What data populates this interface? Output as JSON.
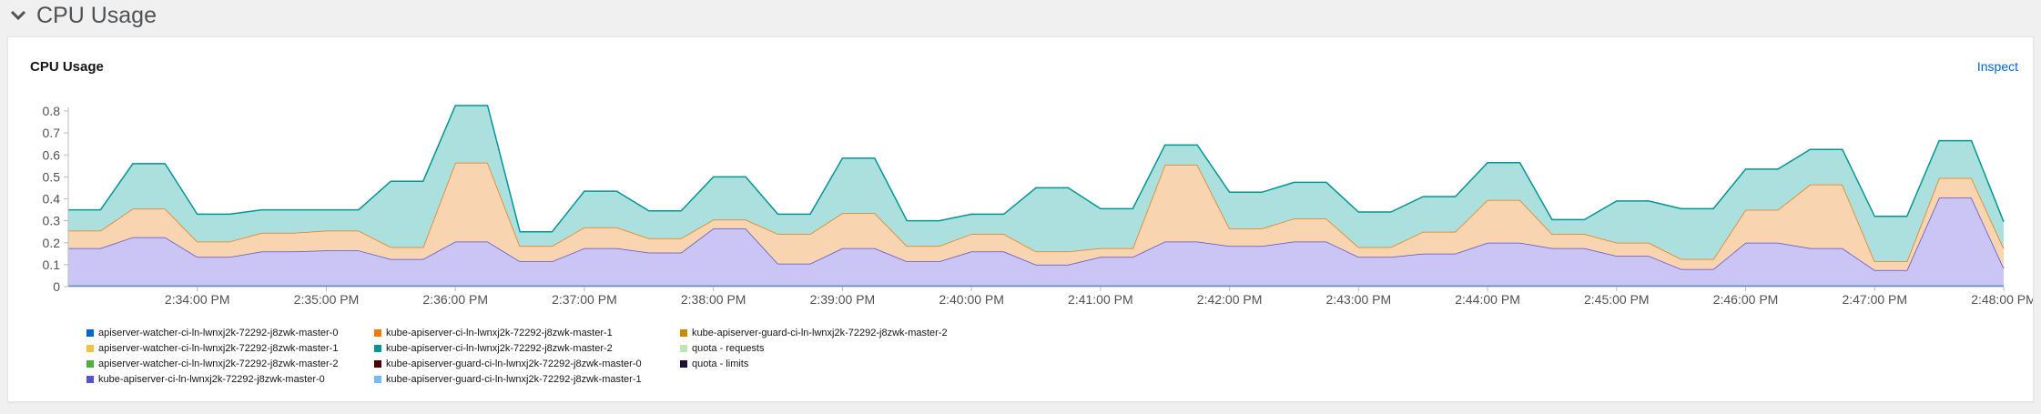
{
  "section": {
    "title": "CPU Usage",
    "toggle_icon": "chevron-down-icon"
  },
  "card": {
    "title": "CPU Usage",
    "inspect_label": "Inspect"
  },
  "chart_data": {
    "type": "area",
    "stacked": true,
    "x": [
      "2:33:00",
      "2:33:15",
      "2:33:30",
      "2:33:45",
      "2:34:00",
      "2:34:15",
      "2:34:30",
      "2:34:45",
      "2:35:00",
      "2:35:15",
      "2:35:30",
      "2:35:45",
      "2:36:00",
      "2:36:15",
      "2:36:30",
      "2:36:45",
      "2:37:00",
      "2:37:15",
      "2:37:30",
      "2:37:45",
      "2:38:00",
      "2:38:15",
      "2:38:30",
      "2:38:45",
      "2:39:00",
      "2:39:15",
      "2:39:30",
      "2:39:45",
      "2:40:00",
      "2:40:15",
      "2:40:30",
      "2:40:45",
      "2:41:00",
      "2:41:15",
      "2:41:30",
      "2:41:45",
      "2:42:00",
      "2:42:15",
      "2:42:30",
      "2:42:45",
      "2:43:00",
      "2:43:15",
      "2:43:30",
      "2:43:45",
      "2:44:00",
      "2:44:15",
      "2:44:30",
      "2:44:45",
      "2:45:00",
      "2:45:15",
      "2:45:30",
      "2:45:45",
      "2:46:00",
      "2:46:15",
      "2:46:30",
      "2:46:45",
      "2:47:00",
      "2:47:15",
      "2:47:30",
      "2:47:45",
      "2:48:00"
    ],
    "x_ticks": [
      "2:34:00 PM",
      "2:35:00 PM",
      "2:36:00 PM",
      "2:37:00 PM",
      "2:38:00 PM",
      "2:39:00 PM",
      "2:40:00 PM",
      "2:41:00 PM",
      "2:42:00 PM",
      "2:43:00 PM",
      "2:44:00 PM",
      "2:45:00 PM",
      "2:46:00 PM",
      "2:47:00 PM",
      "2:48:00 PM"
    ],
    "y_ticks": [
      "0",
      "0.1",
      "0.2",
      "0.3",
      "0.4",
      "0.5",
      "0.6",
      "0.7",
      "0.8"
    ],
    "ylim": [
      0,
      0.8
    ],
    "grid": false,
    "legend_position": "bottom",
    "series": [
      {
        "name": "apiserver-watcher-ci-ln-lwnxj2k-72292-j8zwk-master-0",
        "color": "#0066cc",
        "values": [
          0.005,
          0.005,
          0.005,
          0.005,
          0.005,
          0.005,
          0.005,
          0.005,
          0.005,
          0.005,
          0.005,
          0.005,
          0.005,
          0.005,
          0.005,
          0.005,
          0.005,
          0.005,
          0.005,
          0.005,
          0.005,
          0.005,
          0.005,
          0.005,
          0.005,
          0.005,
          0.005,
          0.005,
          0.005,
          0.005,
          0.005,
          0.005,
          0.005,
          0.005,
          0.005,
          0.005,
          0.005,
          0.005,
          0.005,
          0.005,
          0.005,
          0.005,
          0.005,
          0.005,
          0.005,
          0.005,
          0.005,
          0.005,
          0.005,
          0.005,
          0.005,
          0.005,
          0.005,
          0.005,
          0.005,
          0.005,
          0.005,
          0.005,
          0.005,
          0.005,
          0.005
        ]
      },
      {
        "name": "apiserver-watcher-ci-ln-lwnxj2k-72292-j8zwk-master-1",
        "color": "#f4c145",
        "values": [
          0,
          0,
          0,
          0,
          0,
          0,
          0,
          0,
          0,
          0,
          0,
          0,
          0,
          0,
          0,
          0,
          0,
          0,
          0,
          0,
          0,
          0,
          0,
          0,
          0,
          0,
          0,
          0,
          0,
          0,
          0,
          0,
          0,
          0,
          0,
          0,
          0,
          0,
          0,
          0,
          0,
          0,
          0,
          0,
          0,
          0,
          0,
          0,
          0,
          0,
          0,
          0,
          0,
          0,
          0,
          0,
          0,
          0,
          0,
          0,
          0
        ]
      },
      {
        "name": "apiserver-watcher-ci-ln-lwnxj2k-72292-j8zwk-master-2",
        "color": "#4cb140",
        "values": [
          0,
          0,
          0,
          0,
          0,
          0,
          0,
          0,
          0,
          0,
          0,
          0,
          0,
          0,
          0,
          0,
          0,
          0,
          0,
          0,
          0,
          0,
          0,
          0,
          0,
          0,
          0,
          0,
          0,
          0,
          0,
          0,
          0,
          0,
          0,
          0,
          0,
          0,
          0,
          0,
          0,
          0,
          0,
          0,
          0,
          0,
          0,
          0,
          0,
          0,
          0,
          0,
          0,
          0,
          0,
          0,
          0,
          0,
          0,
          0,
          0
        ]
      },
      {
        "name": "kube-apiserver-ci-ln-lwnxj2k-72292-j8zwk-master-0",
        "color": "#5752d1",
        "fill": "#cbc5f5",
        "values": [
          0.17,
          0.17,
          0.22,
          0.22,
          0.13,
          0.13,
          0.155,
          0.155,
          0.16,
          0.16,
          0.12,
          0.12,
          0.2,
          0.2,
          0.11,
          0.11,
          0.17,
          0.17,
          0.15,
          0.15,
          0.26,
          0.26,
          0.1,
          0.1,
          0.17,
          0.17,
          0.11,
          0.11,
          0.155,
          0.155,
          0.095,
          0.095,
          0.13,
          0.13,
          0.2,
          0.2,
          0.18,
          0.18,
          0.2,
          0.2,
          0.13,
          0.13,
          0.145,
          0.145,
          0.195,
          0.195,
          0.17,
          0.17,
          0.135,
          0.135,
          0.075,
          0.075,
          0.195,
          0.195,
          0.17,
          0.17,
          0.07,
          0.07,
          0.4,
          0.4,
          0.08
        ]
      },
      {
        "name": "kube-apiserver-ci-ln-lwnxj2k-72292-j8zwk-master-1",
        "color": "#ec7a08",
        "fill": "#f8d4b0",
        "values": [
          0.08,
          0.08,
          0.13,
          0.13,
          0.07,
          0.07,
          0.085,
          0.085,
          0.09,
          0.09,
          0.055,
          0.055,
          0.36,
          0.36,
          0.07,
          0.07,
          0.095,
          0.095,
          0.065,
          0.065,
          0.04,
          0.04,
          0.135,
          0.135,
          0.16,
          0.16,
          0.07,
          0.07,
          0.08,
          0.08,
          0.06,
          0.06,
          0.04,
          0.04,
          0.35,
          0.35,
          0.08,
          0.08,
          0.105,
          0.105,
          0.045,
          0.045,
          0.1,
          0.1,
          0.195,
          0.195,
          0.065,
          0.065,
          0.06,
          0.06,
          0.045,
          0.045,
          0.15,
          0.15,
          0.29,
          0.29,
          0.04,
          0.04,
          0.09,
          0.09,
          0.09
        ]
      },
      {
        "name": "kube-apiserver-ci-ln-lwnxj2k-72292-j8zwk-master-2",
        "color": "#009596",
        "fill": "#ace0de",
        "values": [
          0.095,
          0.095,
          0.205,
          0.205,
          0.125,
          0.125,
          0.105,
          0.105,
          0.095,
          0.095,
          0.3,
          0.3,
          0.26,
          0.26,
          0.065,
          0.065,
          0.165,
          0.165,
          0.125,
          0.125,
          0.195,
          0.195,
          0.09,
          0.09,
          0.25,
          0.25,
          0.115,
          0.115,
          0.09,
          0.09,
          0.29,
          0.29,
          0.18,
          0.18,
          0.09,
          0.09,
          0.165,
          0.165,
          0.165,
          0.165,
          0.16,
          0.16,
          0.16,
          0.16,
          0.17,
          0.17,
          0.065,
          0.065,
          0.19,
          0.19,
          0.23,
          0.23,
          0.185,
          0.185,
          0.16,
          0.16,
          0.205,
          0.205,
          0.17,
          0.17,
          0.12
        ]
      },
      {
        "name": "kube-apiserver-guard-ci-ln-lwnxj2k-72292-j8zwk-master-0",
        "color": "#470000",
        "values": [
          0,
          0,
          0,
          0,
          0,
          0,
          0,
          0,
          0,
          0,
          0,
          0,
          0,
          0,
          0,
          0,
          0,
          0,
          0,
          0,
          0,
          0,
          0,
          0,
          0,
          0,
          0,
          0,
          0,
          0,
          0,
          0,
          0,
          0,
          0,
          0,
          0,
          0,
          0,
          0,
          0,
          0,
          0,
          0,
          0,
          0,
          0,
          0,
          0,
          0,
          0,
          0,
          0,
          0,
          0,
          0,
          0,
          0,
          0,
          0,
          0
        ]
      },
      {
        "name": "kube-apiserver-guard-ci-ln-lwnxj2k-72292-j8zwk-master-1",
        "color": "#73bcf7",
        "values": [
          0,
          0,
          0,
          0,
          0,
          0,
          0,
          0,
          0,
          0,
          0,
          0,
          0,
          0,
          0,
          0,
          0,
          0,
          0,
          0,
          0,
          0,
          0,
          0,
          0,
          0,
          0,
          0,
          0,
          0,
          0,
          0,
          0,
          0,
          0,
          0,
          0,
          0,
          0,
          0,
          0,
          0,
          0,
          0,
          0,
          0,
          0,
          0,
          0,
          0,
          0,
          0,
          0,
          0,
          0,
          0,
          0,
          0,
          0,
          0,
          0
        ]
      },
      {
        "name": "kube-apiserver-guard-ci-ln-lwnxj2k-72292-j8zwk-master-2",
        "color": "#c58c00",
        "values": [
          0,
          0,
          0,
          0,
          0,
          0,
          0,
          0,
          0,
          0,
          0,
          0,
          0,
          0,
          0,
          0,
          0,
          0,
          0,
          0,
          0,
          0,
          0,
          0,
          0,
          0,
          0,
          0,
          0,
          0,
          0,
          0,
          0,
          0,
          0,
          0,
          0,
          0,
          0,
          0,
          0,
          0,
          0,
          0,
          0,
          0,
          0,
          0,
          0,
          0,
          0,
          0,
          0,
          0,
          0,
          0,
          0,
          0,
          0,
          0,
          0
        ]
      }
    ],
    "legend": [
      {
        "label": "apiserver-watcher-ci-ln-lwnxj2k-72292-j8zwk-master-0",
        "color": "#0066cc"
      },
      {
        "label": "apiserver-watcher-ci-ln-lwnxj2k-72292-j8zwk-master-1",
        "color": "#f4c145"
      },
      {
        "label": "apiserver-watcher-ci-ln-lwnxj2k-72292-j8zwk-master-2",
        "color": "#4cb140"
      },
      {
        "label": "kube-apiserver-ci-ln-lwnxj2k-72292-j8zwk-master-0",
        "color": "#5752d1"
      },
      {
        "label": "kube-apiserver-ci-ln-lwnxj2k-72292-j8zwk-master-1",
        "color": "#ec7a08"
      },
      {
        "label": "kube-apiserver-ci-ln-lwnxj2k-72292-j8zwk-master-2",
        "color": "#009596"
      },
      {
        "label": "kube-apiserver-guard-ci-ln-lwnxj2k-72292-j8zwk-master-0",
        "color": "#470000"
      },
      {
        "label": "kube-apiserver-guard-ci-ln-lwnxj2k-72292-j8zwk-master-1",
        "color": "#73bcf7"
      },
      {
        "label": "kube-apiserver-guard-ci-ln-lwnxj2k-72292-j8zwk-master-2",
        "color": "#c58c00"
      },
      {
        "label": "quota - requests",
        "color": "#bde5b8"
      },
      {
        "label": "quota - limits",
        "color": "#1c0f3a"
      }
    ]
  }
}
